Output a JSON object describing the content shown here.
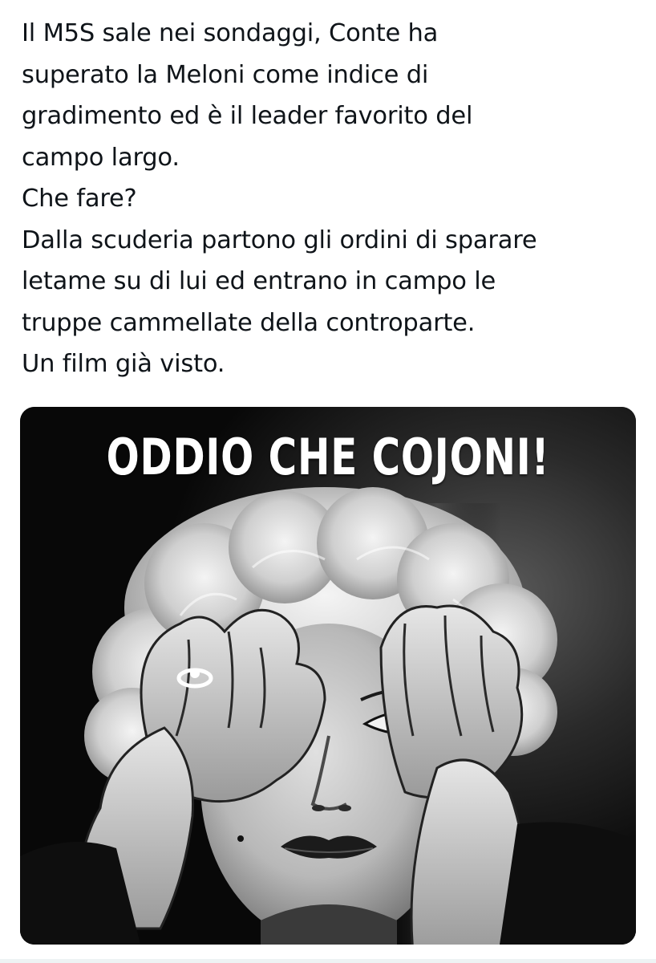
{
  "tweet": {
    "lines": [
      "Il M5S sale nei sondaggi, Conte ha",
      "superato la Meloni come indice di",
      "gradimento ed è il leader favorito del",
      "campo largo.",
      "Che fare?",
      "Dalla scuderia partono gli ordini di sparare",
      "letame su di lui ed entrano in campo le",
      "truppe cammellate della controparte.",
      "Un film già visto."
    ]
  },
  "media": {
    "caption": "ODDIO CHE COJONI!",
    "style": "black-and-white"
  }
}
